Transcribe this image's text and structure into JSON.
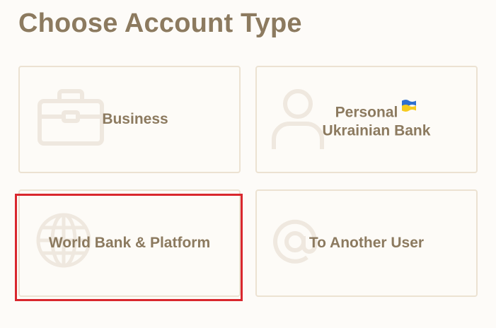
{
  "page": {
    "title": "Choose Account Type"
  },
  "cards": {
    "business": {
      "label": "Business",
      "icon": "briefcase-icon"
    },
    "personal": {
      "label_line1": "Personal",
      "label_line2": "Ukrainian Bank",
      "icon": "person-icon",
      "flag": "ukraine-flag-icon"
    },
    "world": {
      "label": "World Bank & Platform",
      "icon": "globe-icon"
    },
    "another_user": {
      "label": "To Another User",
      "icon": "at-sign-icon"
    }
  },
  "colors": {
    "title": "#8c7a5f",
    "card_border": "#ece2d2",
    "icon_watermark": "#efe8df",
    "selection": "#d9272e",
    "flag_blue": "#2f6fd0",
    "flag_yellow": "#f6cb1f"
  }
}
